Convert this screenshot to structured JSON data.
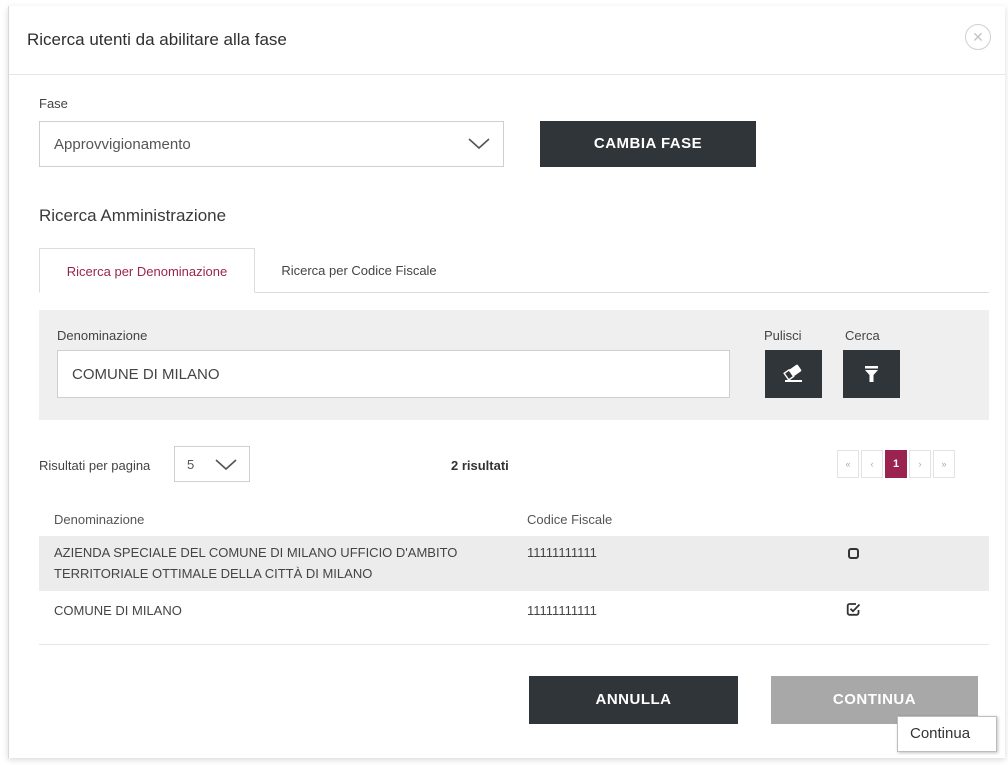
{
  "modal": {
    "title": "Ricerca utenti da abilitare alla fase",
    "close_icon": "close-icon"
  },
  "fase": {
    "label": "Fase",
    "selected": "Approvvigionamento",
    "change_button": "CAMBIA FASE"
  },
  "section": {
    "title": "Ricerca Amministrazione"
  },
  "tabs": [
    {
      "label": "Ricerca per Denominazione",
      "active": true
    },
    {
      "label": "Ricerca per Codice Fiscale",
      "active": false
    }
  ],
  "search": {
    "label": "Denominazione",
    "value": "COMUNE DI MILANO",
    "clear_label": "Pulisci",
    "clear_icon": "eraser-icon",
    "search_label": "Cerca",
    "search_icon": "filter-icon"
  },
  "results": {
    "per_page_label": "Risultati per pagina",
    "per_page_value": "5",
    "count_text": "2 risultati"
  },
  "pagination": {
    "first": "«",
    "prev": "‹",
    "current": "1",
    "next": "›",
    "last": "»"
  },
  "table": {
    "headers": [
      "Denominazione",
      "Codice Fiscale"
    ],
    "rows": [
      {
        "name_line1": "AZIENDA SPECIALE DEL COMUNE DI MILANO UFFICIO D'AMBITO",
        "name_line2": "TERRITORIALE OTTIMALE DELLA CITTÀ DI MILANO",
        "codice_fiscale": "11111111111",
        "checked": false
      },
      {
        "name_line1": "COMUNE DI MILANO",
        "name_line2": "",
        "codice_fiscale": "11111111111",
        "checked": true
      }
    ]
  },
  "footer": {
    "cancel_button": "ANNULLA",
    "continue_button": "CONTINUA",
    "tooltip": "Continua"
  },
  "colors": {
    "accent": "#9b2350",
    "dark_button": "#30353a",
    "disabled_button": "#a8a8a8",
    "panel_bg": "#efefef"
  }
}
